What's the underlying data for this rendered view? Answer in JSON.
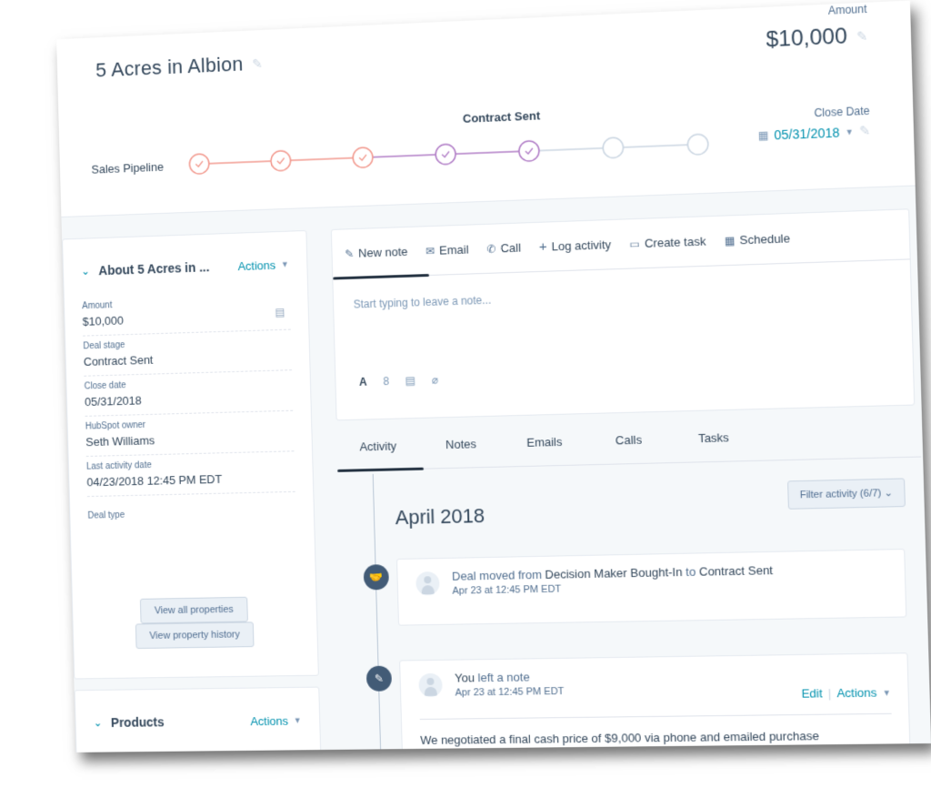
{
  "header": {
    "deal_title": "5 Acres in Albion",
    "amount_label": "Amount",
    "amount_value": "$10,000",
    "pipeline_label": "Sales Pipeline",
    "current_stage": "Contract Sent",
    "close_date_label": "Close Date",
    "close_date_value": "05/31/2018",
    "icons": {
      "edit": "pencil-icon",
      "calendar": "calendar-icon",
      "dropdown": "caret-down-icon"
    }
  },
  "pipeline": {
    "stages_total": 7,
    "stages_completed": 5,
    "current_stage_index": 5,
    "colors": {
      "early": "#f2998e",
      "late": "#b07cc6",
      "pending": "#cbd6e2"
    }
  },
  "about_card": {
    "title": "About 5 Acres in ...",
    "actions_label": "Actions",
    "properties": [
      {
        "label": "Amount",
        "value": "$10,000",
        "icon": "details-icon"
      },
      {
        "label": "Deal stage",
        "value": "Contract Sent"
      },
      {
        "label": "Close date",
        "value": "05/31/2018"
      },
      {
        "label": "HubSpot owner",
        "value": "Seth Williams"
      },
      {
        "label": "Last activity date",
        "value": "04/23/2018 12:45 PM EDT"
      },
      {
        "label": "Deal type",
        "value": ""
      }
    ],
    "view_all_label": "View all properties",
    "view_history_label": "View property history"
  },
  "products_card": {
    "title": "Products",
    "actions_label": "Actions"
  },
  "composer": {
    "tabs": [
      {
        "label": "New note",
        "icon": "edit-note-icon"
      },
      {
        "label": "Email",
        "icon": "email-icon"
      },
      {
        "label": "Call",
        "icon": "phone-icon"
      },
      {
        "label": "Log activity",
        "icon": "plus-icon"
      },
      {
        "label": "Create task",
        "icon": "task-icon"
      },
      {
        "label": "Schedule",
        "icon": "calendar-icon"
      }
    ],
    "active_tab": "New note",
    "placeholder": "Start typing to leave a note...",
    "toolbar": [
      "text-format-icon",
      "link-icon",
      "snippet-icon",
      "attachment-icon"
    ]
  },
  "activity": {
    "tabs": [
      "Activity",
      "Notes",
      "Emails",
      "Calls",
      "Tasks"
    ],
    "active_tab": "Activity",
    "filter_label": "Filter activity (6/7)",
    "month": "April 2018",
    "events": [
      {
        "type": "deal-stage-change",
        "icon": "handshake-icon",
        "prefix": "Deal moved from ",
        "from": "Decision Maker Bought-In",
        "mid": " to ",
        "to": "Contract Sent",
        "time": "Apr 23 at 12:45 PM EDT"
      },
      {
        "type": "note",
        "icon": "note-icon",
        "actor": "You",
        "action": " left a note",
        "time": "Apr 23 at 12:45 PM EDT",
        "edit_label": "Edit",
        "actions_label": "Actions",
        "body": "We negotiated a final cash price of $9,000 via phone and emailed purchase"
      }
    ]
  }
}
